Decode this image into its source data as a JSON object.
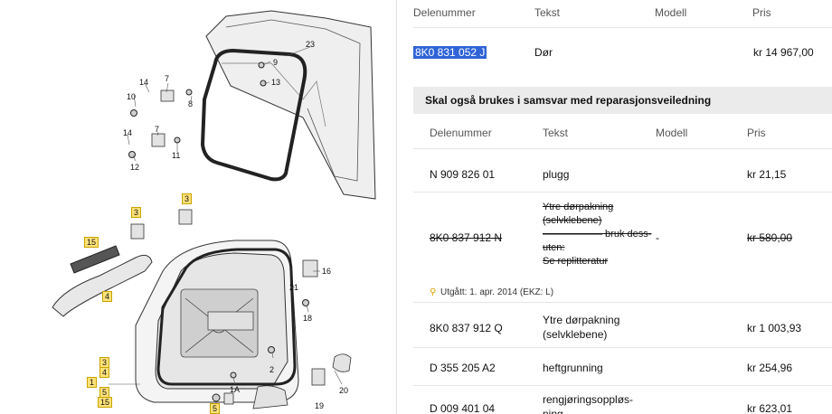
{
  "diagram": {
    "callouts": [
      "23",
      "9",
      "13",
      "14",
      "7",
      "10",
      "8",
      "14",
      "7",
      "12",
      "11",
      "3",
      "3",
      "15",
      "4",
      "16",
      "21",
      "18",
      "3",
      "4",
      "1",
      "5",
      "15",
      "1A",
      "2",
      "20",
      "19",
      "5"
    ]
  },
  "main_row": {
    "headers": [
      "Delenummer",
      "Tekst",
      "Modell",
      "Pris"
    ],
    "part_number": "8K0 831 052 J",
    "text": "Dør",
    "model": "",
    "price": "kr 14 967,00"
  },
  "section": {
    "title": "Skal også brukes i samsvar med reparasjonsveiledning",
    "headers": [
      "Delenummer",
      "Tekst",
      "Modell",
      "Pris"
    ]
  },
  "rows": [
    {
      "part": "N  909 826 01",
      "text": "plugg",
      "model": "",
      "price": "kr 21,15"
    },
    {
      "part": "8K0 837 912 N",
      "text_lines": [
        "Ytre dørpakning",
        "(selvklebene)",
        "—————— bruk dess-",
        "uten:",
        "Se replitteratur"
      ],
      "model": "-",
      "price": "kr 580,00",
      "struck": true
    },
    {
      "part": "8K0 837 912 Q",
      "text_lines": [
        "Ytre dørpakning",
        "(selvklebene)"
      ],
      "model": "",
      "price": "kr 1 003,93"
    },
    {
      "part": "D   355 205 A2",
      "text": "heftgrunning",
      "model": "",
      "price": "kr 254,96"
    },
    {
      "part": "D   009 401 04",
      "text_lines": [
        "rengjøringsoppløs-",
        "ning"
      ],
      "model": "",
      "price": "kr 623,01"
    }
  ],
  "note": {
    "icon": "pin-icon",
    "text": "Utgått: 1. apr. 2014 (EKZ: L)"
  }
}
